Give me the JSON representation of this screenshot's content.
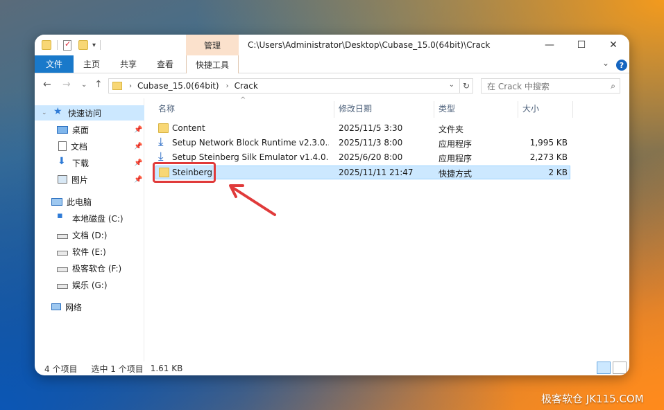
{
  "window": {
    "title_path": "C:\\Users\\Administrator\\Desktop\\Cubase_15.0(64bit)\\Crack",
    "context_tab_top": "管理",
    "minimize": "—",
    "maximize": "☐",
    "close": "✕"
  },
  "ribbon": {
    "file_tab": "文件",
    "tabs": [
      "主页",
      "共享",
      "查看"
    ],
    "context_tab": "快捷工具",
    "collapse": "⌄",
    "help": "?"
  },
  "nav": {
    "back": "←",
    "forward": "→",
    "recent": "⌄",
    "up": "↑",
    "breadcrumbs": [
      "Cubase_15.0(64bit)",
      "Crack"
    ],
    "breadcrumb_sep": "›",
    "dropdown": "⌄",
    "refresh": "↻",
    "search_placeholder": "在 Crack 中搜索",
    "search_icon": "⌕"
  },
  "sidebar": {
    "items": [
      {
        "label": "快速访问",
        "icon": "star-icon",
        "pinned": false,
        "selected": true
      },
      {
        "label": "桌面",
        "icon": "desktop-icon",
        "pinned": true
      },
      {
        "label": "文档",
        "icon": "document-icon",
        "pinned": true
      },
      {
        "label": "下载",
        "icon": "download-icon",
        "pinned": true
      },
      {
        "label": "图片",
        "icon": "picture-icon",
        "pinned": true
      },
      {
        "label": "此电脑",
        "icon": "computer-icon",
        "pinned": false
      },
      {
        "label": "本地磁盘 (C:)",
        "icon": "system-drive-icon",
        "pinned": false
      },
      {
        "label": "文档 (D:)",
        "icon": "drive-icon",
        "pinned": false
      },
      {
        "label": "软件 (E:)",
        "icon": "drive-icon",
        "pinned": false
      },
      {
        "label": "极客软仓 (F:)",
        "icon": "drive-icon",
        "pinned": false
      },
      {
        "label": "娱乐 (G:)",
        "icon": "drive-icon",
        "pinned": false
      },
      {
        "label": "网络",
        "icon": "network-icon",
        "pinned": false
      }
    ],
    "pin_glyph": "📌"
  },
  "columns": {
    "name": "名称",
    "modified": "修改日期",
    "type": "类型",
    "size": "大小",
    "sort_glyph": "^"
  },
  "files": [
    {
      "name": "Content",
      "modified": "2025/11/5 3:30",
      "type": "文件夹",
      "size": "",
      "icon": "folder-icon"
    },
    {
      "name": "Setup Network Block Runtime v2.3.0....",
      "modified": "2025/11/3 8:00",
      "type": "应用程序",
      "size": "1,995 KB",
      "icon": "setup-icon"
    },
    {
      "name": "Setup Steinberg Silk Emulator v1.4.0....",
      "modified": "2025/6/20 8:00",
      "type": "应用程序",
      "size": "2,273 KB",
      "icon": "setup-icon"
    },
    {
      "name": "Steinberg",
      "modified": "2025/11/11 21:47",
      "type": "快捷方式",
      "size": "2 KB",
      "icon": "folder-shortcut-icon",
      "selected": true
    }
  ],
  "status": {
    "count": "4 个项目",
    "selected": "选中 1 个项目",
    "size": "1.61 KB"
  },
  "watermark": "极客软仓 JK115.COM",
  "colors": {
    "accent": "#1979ca",
    "selection": "#cce8ff",
    "highlight": "#e03a3a"
  }
}
